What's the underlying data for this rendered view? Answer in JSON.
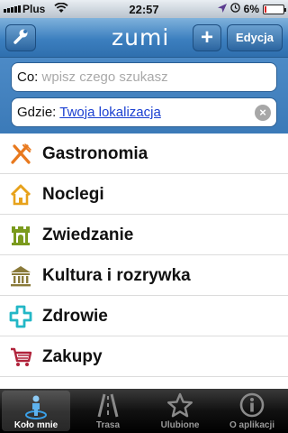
{
  "status_bar": {
    "carrier": "Plus",
    "time": "22:57",
    "battery_percent": "6%",
    "battery_level": 0.06,
    "icons": [
      "signal-icon",
      "wifi-icon",
      "location-arrow-icon",
      "clock-icon",
      "battery-icon"
    ]
  },
  "header": {
    "logo": "zumi",
    "add_label": "+",
    "edit_label": "Edycja",
    "settings_icon": "wrench-icon"
  },
  "search": {
    "what_label": "Co:",
    "what_placeholder": "wpisz czego szukasz",
    "where_label": "Gdzie:",
    "where_value": "Twoja lokalizacja",
    "clear_label": "×"
  },
  "categories": [
    {
      "label": "Gastronomia",
      "icon": "fork-knife-icon",
      "color": "#e8791e"
    },
    {
      "label": "Noclegi",
      "icon": "house-icon",
      "color": "#e7a21b"
    },
    {
      "label": "Zwiedzanie",
      "icon": "castle-icon",
      "color": "#7a9a1c"
    },
    {
      "label": "Kultura i rozrywka",
      "icon": "museum-icon",
      "color": "#8a7a3a"
    },
    {
      "label": "Zdrowie",
      "icon": "medical-cross-icon",
      "color": "#23b7c6"
    },
    {
      "label": "Zakupy",
      "icon": "shopping-cart-icon",
      "color": "#b0223a"
    }
  ],
  "tabs": [
    {
      "label": "Koło mnie",
      "icon": "person-location-icon",
      "active": true
    },
    {
      "label": "Trasa",
      "icon": "road-icon",
      "active": false
    },
    {
      "label": "Ulubione",
      "icon": "star-icon",
      "active": false
    },
    {
      "label": "O aplikacji",
      "icon": "info-icon",
      "active": false
    }
  ]
}
